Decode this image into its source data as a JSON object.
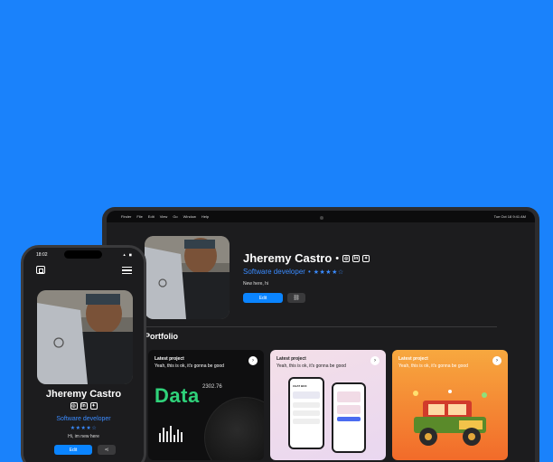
{
  "laptop": {
    "menubar": {
      "items": [
        "Finder",
        "File",
        "Edit",
        "View",
        "Go",
        "Window",
        "Help"
      ],
      "clock": "Tue Oct 18  9:41 AM"
    },
    "profile": {
      "name": "Jheremy Castro",
      "separator": "•",
      "role": "Software developer",
      "stars": "★★★★☆",
      "bio": "New here, hi",
      "edit_label": "Edit",
      "share_icon": "link-icon"
    },
    "portfolio": {
      "title": "Portfolio",
      "cards": [
        {
          "title": "Latest project",
          "subtitle": "Yeah, this is ok, it's gonna be good",
          "data_word": "Data",
          "data_value": "2302.76"
        },
        {
          "title": "Latest project",
          "subtitle": "Yeah, this is ok, it's gonna be good",
          "inner_title": "CHAT BOX"
        },
        {
          "title": "Latest project",
          "subtitle": "Yeah, this is ok, it's gonna be good"
        }
      ]
    }
  },
  "phone": {
    "time": "18:02",
    "status": "▲ ◼",
    "name": "Jheremy Castro",
    "role": "Software developer",
    "stars": "★★★★☆",
    "bio": "Hi, im new here",
    "edit_label": "Edit",
    "share_icon": "share-icon"
  },
  "colors": {
    "background": "#1a82fb",
    "accent": "#0a84ff",
    "surface": "#1c1c1e",
    "data_green": "#2fd27a"
  }
}
